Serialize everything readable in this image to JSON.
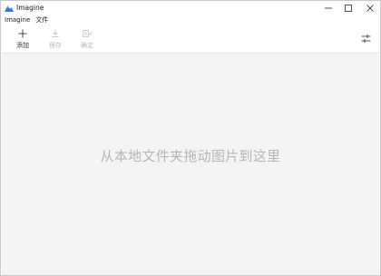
{
  "window": {
    "title": "Imagine"
  },
  "menu": {
    "items": [
      {
        "label": "Imagine"
      },
      {
        "label": "文件"
      }
    ]
  },
  "toolbar": {
    "add_label": "添加",
    "save_label": "保存",
    "confirm_label": "确定",
    "save_enabled": false,
    "confirm_enabled": false
  },
  "main": {
    "drop_hint": "从本地文件夹拖动图片到这里"
  },
  "colors": {
    "logo_accent": "#2b7bd6",
    "drop_area_bg": "#f4f4f4",
    "disabled_text": "#b8b8b8"
  },
  "icons": {
    "logo": "mountain-logo-icon",
    "add": "plus-icon",
    "save": "download-icon",
    "confirm": "confirm-icon",
    "settings": "sliders-icon"
  }
}
